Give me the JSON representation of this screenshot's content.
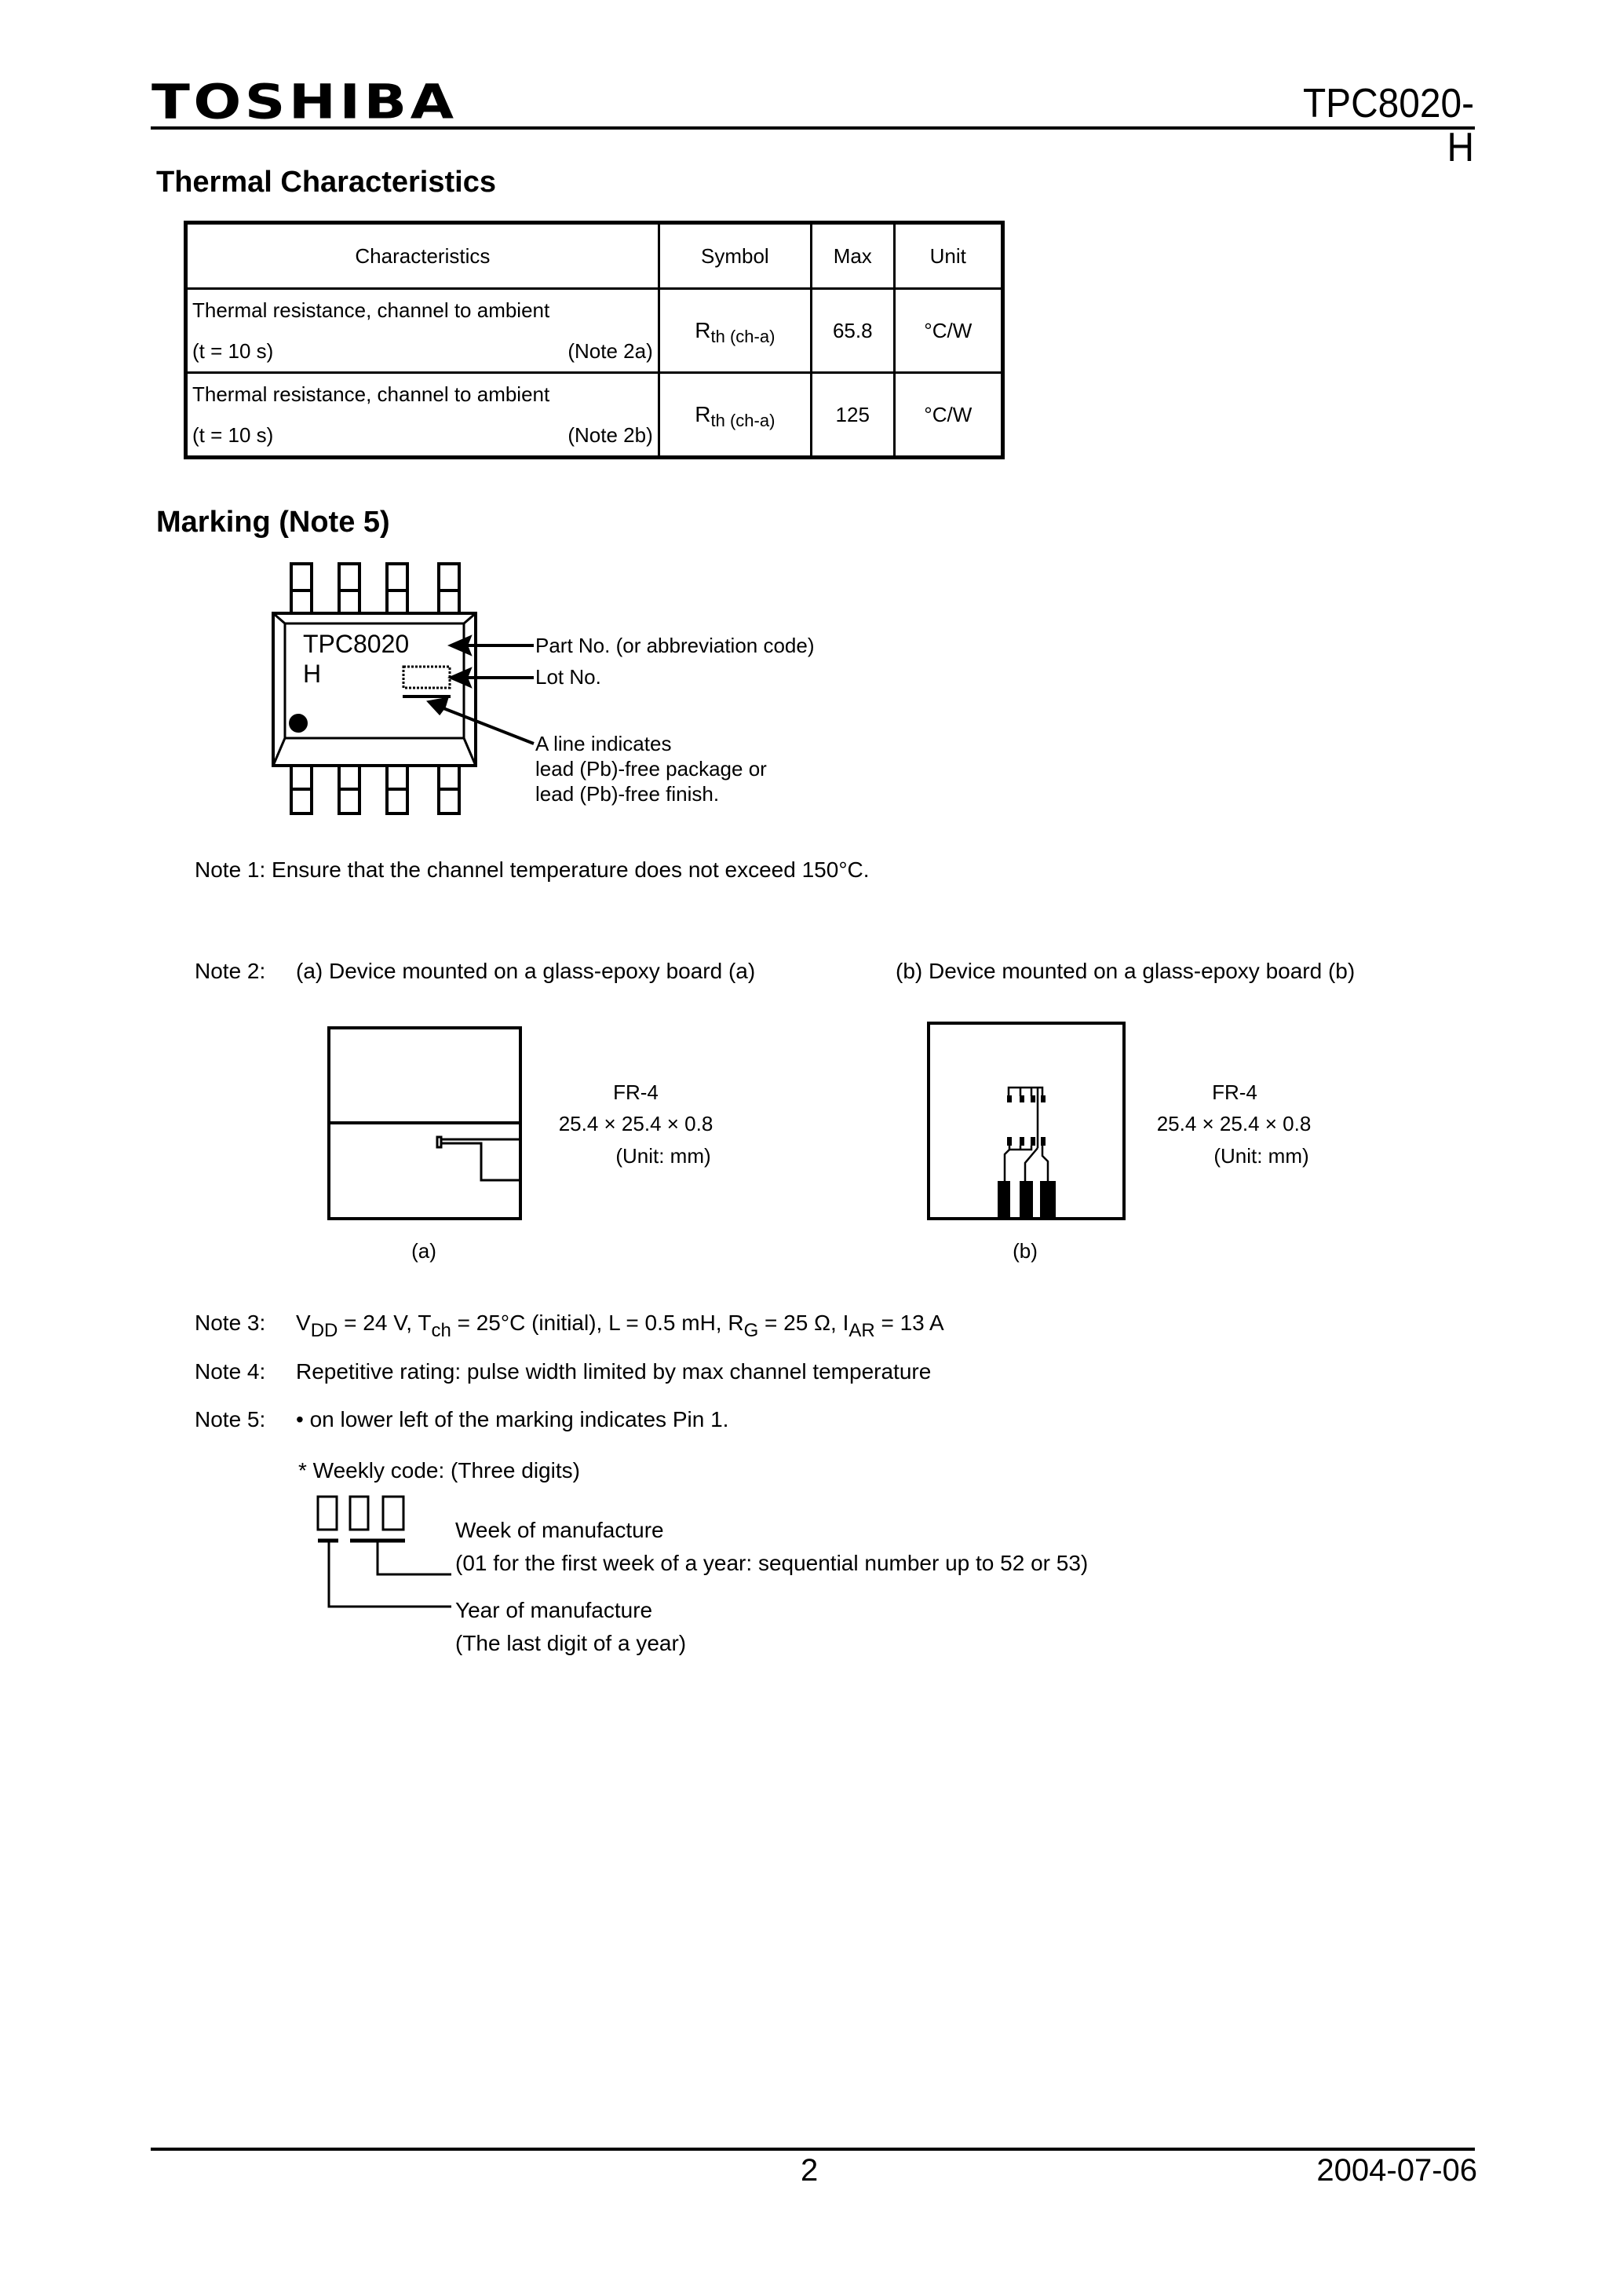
{
  "header": {
    "brand": "TOSHIBA",
    "part_number": "TPC8020-H"
  },
  "thermal": {
    "title": "Thermal Characteristics",
    "columns": [
      "Characteristics",
      "Symbol",
      "Max",
      "Unit"
    ],
    "rows": [
      {
        "characteristic": "Thermal resistance, channel to ambient",
        "condition": "(t = 10 s)",
        "note": "(Note 2a)",
        "symbol_main": "R",
        "symbol_sub": "th (ch-a)",
        "max": "65.8",
        "unit": "°C/W"
      },
      {
        "characteristic": "Thermal resistance, channel to ambient",
        "condition": "(t = 10 s)",
        "note": "(Note 2b)",
        "symbol_main": "R",
        "symbol_sub": "th (ch-a)",
        "max": "125",
        "unit": "°C/W"
      }
    ]
  },
  "marking": {
    "title": "Marking (Note 5)",
    "chip_line1": "TPC8020",
    "chip_line2": "H",
    "annotations": {
      "part_no": "Part No. (or abbreviation code)",
      "lot_no": "Lot No.",
      "lead_free_1": "A line indicates",
      "lead_free_2": "lead (Pb)-free package or",
      "lead_free_3": "lead (Pb)-free finish."
    }
  },
  "notes": {
    "note1": "Note 1: Ensure that the channel temperature does not exceed 150°C.",
    "note2_label": "Note 2:",
    "note2_a": "(a) Device mounted on a glass-epoxy board (a)",
    "note2_b": "(b) Device mounted on a glass-epoxy board (b)",
    "board_a": {
      "material": "FR-4",
      "size": "25.4 × 25.4 × 0.8",
      "unit": "(Unit: mm)",
      "caption": "(a)"
    },
    "board_b": {
      "material": "FR-4",
      "size": "25.4 × 25.4 × 0.8",
      "unit": "(Unit: mm)",
      "caption": "(b)"
    },
    "note3_label": "Note 3:",
    "note3": {
      "vdd": "V",
      "vdd_sub": "DD",
      "vdd_val": " = 24 V, ",
      "tch": "T",
      "tch_sub": "ch",
      "tch_val": " = 25°C (initial), L = 0.5 mH, ",
      "rg": "R",
      "rg_sub": "G",
      "rg_val": " = 25 Ω, ",
      "iar": "I",
      "iar_sub": "AR",
      "iar_val": " = 13 A"
    },
    "note4_label": "Note 4:",
    "note4": "Repetitive rating: pulse width limited by max channel temperature",
    "note5_label": "Note 5:",
    "note5": "• on lower left of the marking indicates Pin 1.",
    "weekly_title": "*  Weekly code: (Three digits)",
    "week_label": "Week of manufacture",
    "week_desc": "(01 for the first week of a year: sequential number up to 52 or 53)",
    "year_label": "Year of manufacture",
    "year_desc": "(The last digit of a year)"
  },
  "footer": {
    "page": "2",
    "date": "2004-07-06"
  }
}
